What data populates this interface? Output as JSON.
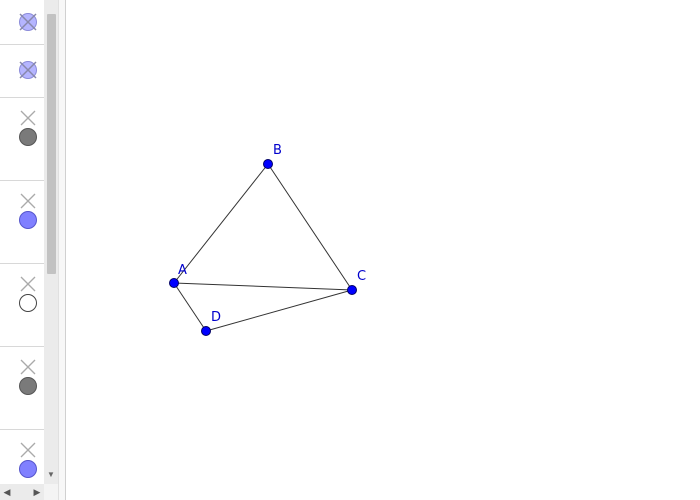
{
  "algebra_view": {
    "items": [
      {
        "toggle": "crossed-circle",
        "color": "#9a9aff",
        "hidden": true
      },
      {
        "toggle": "crossed-circle",
        "color": "#9a9aff",
        "hidden": true
      },
      {
        "toggle": "circle",
        "color": "#7a7a7a",
        "hidden": false
      },
      {
        "toggle": "circle",
        "color": "#8080ff",
        "hidden": false
      },
      {
        "toggle": "circle",
        "color": "#ffffff",
        "hidden": false
      },
      {
        "toggle": "circle",
        "color": "#7a7a7a",
        "hidden": false
      },
      {
        "toggle": "circle",
        "color": "#8080ff",
        "hidden": false
      }
    ]
  },
  "graphics": {
    "points": [
      {
        "name": "A",
        "color": "#0000ff"
      },
      {
        "name": "B",
        "color": "#0000ff"
      },
      {
        "name": "C",
        "color": "#0000ff"
      },
      {
        "name": "D",
        "color": "#0000ff"
      }
    ],
    "segments": [
      [
        "A",
        "B"
      ],
      [
        "B",
        "C"
      ],
      [
        "A",
        "C"
      ],
      [
        "A",
        "D"
      ],
      [
        "D",
        "C"
      ]
    ]
  }
}
